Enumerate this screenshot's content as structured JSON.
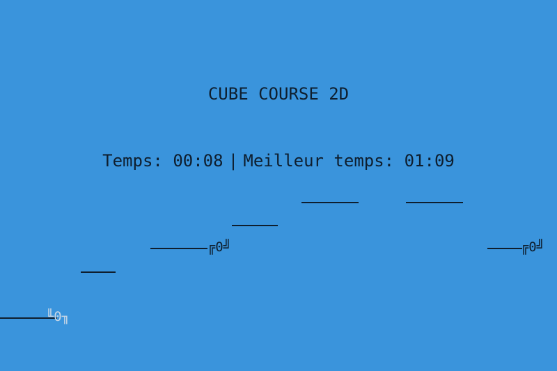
{
  "colors": {
    "background": "#3A94DC",
    "text": "#0E1E2E",
    "platform": "#0E1E2E",
    "player": "#C6D6E6",
    "enemy": "#0E1E2E"
  },
  "hud": {
    "title": "CUBE COURSE 2D",
    "time_label": "Temps:",
    "time_value": "00:08",
    "separator": "|",
    "best_label": "Meilleur temps:",
    "best_value": "01:09"
  },
  "player": {
    "glyph": "╙0╖",
    "icon": "player-cube-icon"
  },
  "enemies": [
    {
      "glyph": "╔0╝",
      "icon": "enemy-cube-icon"
    },
    {
      "glyph": "╔0╝",
      "icon": "enemy-cube-icon"
    }
  ],
  "platform_count": 7
}
